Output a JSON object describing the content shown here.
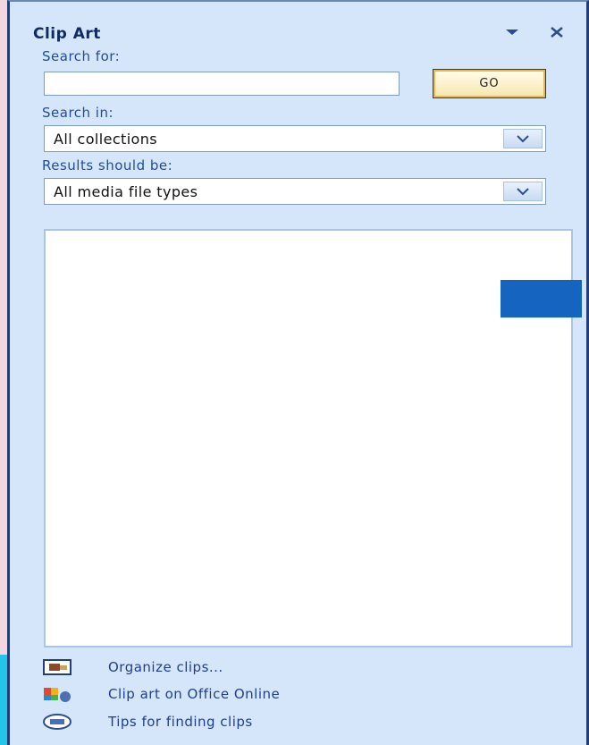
{
  "pane": {
    "title": "Clip Art"
  },
  "search": {
    "label": "Search for:",
    "value": "",
    "go_label": "GO"
  },
  "search_in": {
    "label": "Search in:",
    "selected": "All collections"
  },
  "results_type": {
    "label": "Results should be:",
    "selected": "All media file types"
  },
  "links": [
    {
      "label": "Organize clips...",
      "icon": "organize-clips-icon"
    },
    {
      "label": "Clip art on Office Online",
      "icon": "office-online-icon"
    },
    {
      "label": "Tips for finding clips",
      "icon": "tips-icon"
    }
  ],
  "colors": {
    "pane_bg": "#d6e6fa",
    "border": "#243c78",
    "link_text": "#1f3e8f",
    "label_text": "#1f4d9c",
    "go_border": "#e8b850",
    "page_bg": "#f3d6de",
    "blue_tab": "#1565c0"
  }
}
